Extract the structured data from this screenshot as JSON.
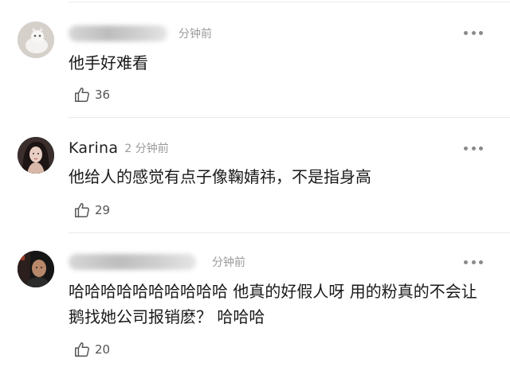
{
  "comments": [
    {
      "user_name": "",
      "time": "分钟前",
      "text": "他手好难看",
      "likes": "36",
      "avatar_icon": "avatar-cat-icon"
    },
    {
      "user_name": "Karina",
      "time": "2 分钟前",
      "text": "他给人的感觉有点子像鞠婧祎，不是指身高",
      "likes": "29",
      "avatar_icon": "avatar-woman-icon"
    },
    {
      "user_name": "",
      "time": "分钟前",
      "text": "哈哈哈哈哈哈哈哈哈哈 他真的好假人呀 用的粉真的不会让鹅找她公司报销麽？ 哈哈哈",
      "likes": "20",
      "avatar_icon": "avatar-man-icon"
    }
  ],
  "icons": {
    "like": "thumbs-up-icon",
    "more": "more-dots-icon"
  },
  "colors": {
    "text": "#1a1a1a",
    "meta": "#9a9a9a",
    "divider": "#e9e9e9"
  }
}
